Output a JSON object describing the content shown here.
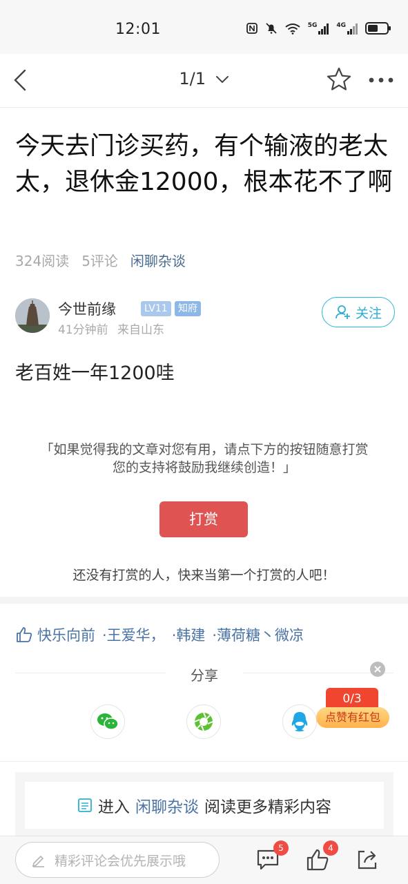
{
  "status_bar": {
    "time": "12:01",
    "signal_1": "5G",
    "signal_2": "4G"
  },
  "nav": {
    "page_indicator": "1/1"
  },
  "post": {
    "title": "今天去门诊买药，有个输液的老太太，退休金12000，根本花不了啊",
    "reads": "324阅读",
    "comments": "5评论",
    "category": "闲聊杂谈",
    "body": "老百姓一年1200哇"
  },
  "author": {
    "name": "今世前缘",
    "level": "LV11",
    "rank": "知府",
    "time": "41分钟前",
    "location": "来自山东",
    "follow_label": "关注"
  },
  "reward": {
    "tip_line1": "「如果觉得我的文章对您有用，请点下方的按钮随意打赏",
    "tip_line2": "您的支持将鼓励我继续创造！」",
    "button": "打赏",
    "empty_text": "还没有打赏的人，快来当第一个打赏的人吧！"
  },
  "likers": [
    "快乐向前",
    "·王爱华，",
    "·韩建",
    "·薄荷糖丶微凉"
  ],
  "share": {
    "label": "分享",
    "targets": [
      "wechat-icon",
      "moments-icon",
      "qq-icon"
    ]
  },
  "red_packet": {
    "progress": "0/3",
    "label": "点赞有红包"
  },
  "enter_board": {
    "prefix": "进入",
    "category": "闲聊杂谈",
    "suffix": "阅读更多精彩内容"
  },
  "bottom_bar": {
    "comment_placeholder": "精彩评论会优先展示哦",
    "comment_count": "5",
    "like_count": "4"
  },
  "colors": {
    "accent_blue": "#4a73a5",
    "follow_cyan": "#2aaed3",
    "reward_red": "#e05353"
  }
}
